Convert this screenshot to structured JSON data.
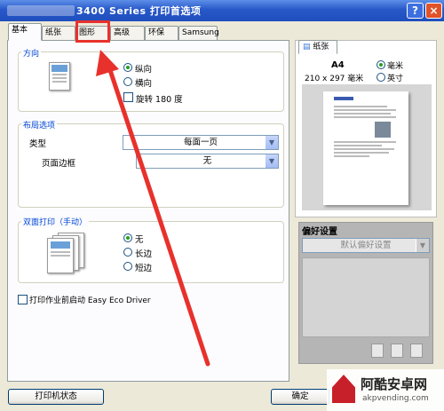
{
  "window": {
    "title": "3400 Series 打印首选项",
    "help": "?",
    "close": "×"
  },
  "tabs": [
    "基本",
    "纸张",
    "图形",
    "高级",
    "环保",
    "Samsung"
  ],
  "orientation": {
    "title": "方向",
    "options": [
      "纵向",
      "横向"
    ],
    "selected": "纵向",
    "rotate_label": "旋转 180 度"
  },
  "layout": {
    "title": "布局选项",
    "type_label": "类型",
    "type_value": "每面一页",
    "border_label": "页面边框",
    "border_value": "无"
  },
  "duplex": {
    "title": "双面打印（手动）",
    "options": [
      "无",
      "长边",
      "短边"
    ],
    "selected": "无"
  },
  "eco": {
    "label": "打印作业前启动 Easy Eco Driver"
  },
  "paper": {
    "tab": "纸张",
    "size": "A4",
    "dims": "210 x 297 毫米",
    "units": [
      "毫米",
      "英寸"
    ],
    "selected_unit": "毫米"
  },
  "prefs": {
    "title": "偏好设置",
    "placeholder": "默认偏好设置"
  },
  "buttons": {
    "printer_status": "打印机状态",
    "ok": "确定"
  },
  "watermark": {
    "text": "阿酷安卓网",
    "url": "akpvending.com"
  },
  "colors": {
    "title_blue": "#2858c8",
    "group_title": "#0046d5",
    "arrow_red": "#e8312c"
  }
}
